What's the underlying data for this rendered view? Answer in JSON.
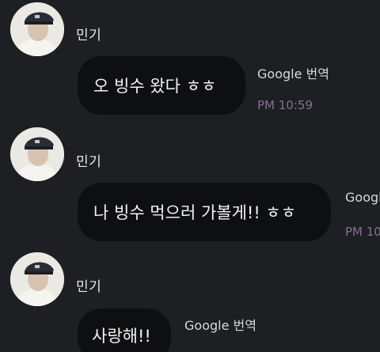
{
  "messages": [
    {
      "sender": "민기",
      "text": "오 빙수 왔다 ㅎㅎ",
      "translate_label": "Google 번역",
      "time": "PM 10:59"
    },
    {
      "sender": "민기",
      "text": "나 빙수 먹으러 가볼게!! ㅎㅎ",
      "translate_label": "Google",
      "time": "PM 10"
    },
    {
      "sender": "민기",
      "text": "사랑해!!",
      "translate_label": "Google 번역",
      "time": ""
    }
  ]
}
